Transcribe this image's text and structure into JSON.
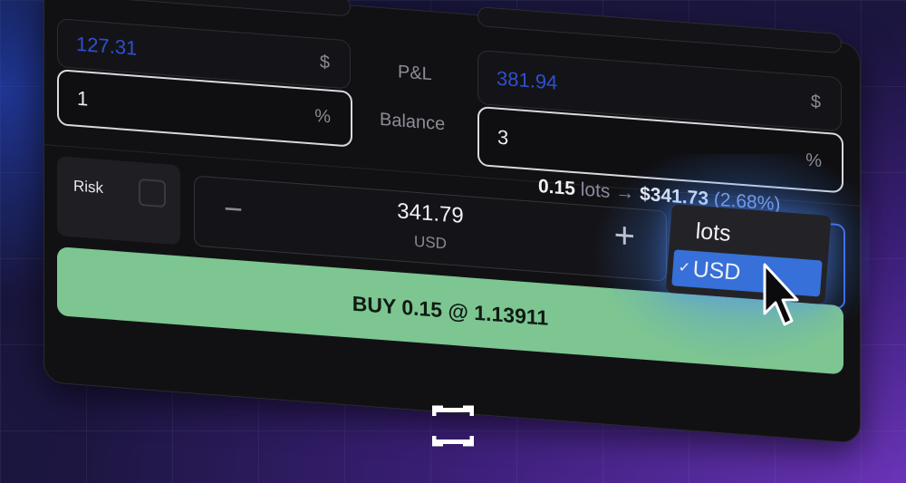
{
  "fields": {
    "left_top_value": "127.31",
    "left_top_unit": "$",
    "left_input_value": "1",
    "left_input_unit": "%",
    "right_top_value": "381.94",
    "right_top_unit": "$",
    "right_input_value": "3",
    "right_input_unit": "%",
    "pnl_label": "P&L",
    "balance_label": "Balance"
  },
  "summary": {
    "lots": "0.15",
    "lots_unit": "lots",
    "arrow": "→",
    "usd_amount": "$341.73",
    "percent": "(2.68%)"
  },
  "risk": {
    "label": "Risk"
  },
  "stepper": {
    "minus": "−",
    "plus": "+",
    "value": "341.79",
    "unit": "USD"
  },
  "buy_button": {
    "label": "BUY 0.15 @ 1.13911"
  },
  "unit_dropdown": {
    "options": [
      "lots",
      "USD"
    ],
    "selected": "USD",
    "check": "✓"
  },
  "colors": {
    "accent_blue": "#3670d8",
    "buy_green": "#7dc591",
    "value_blue": "#2f4fd0"
  }
}
